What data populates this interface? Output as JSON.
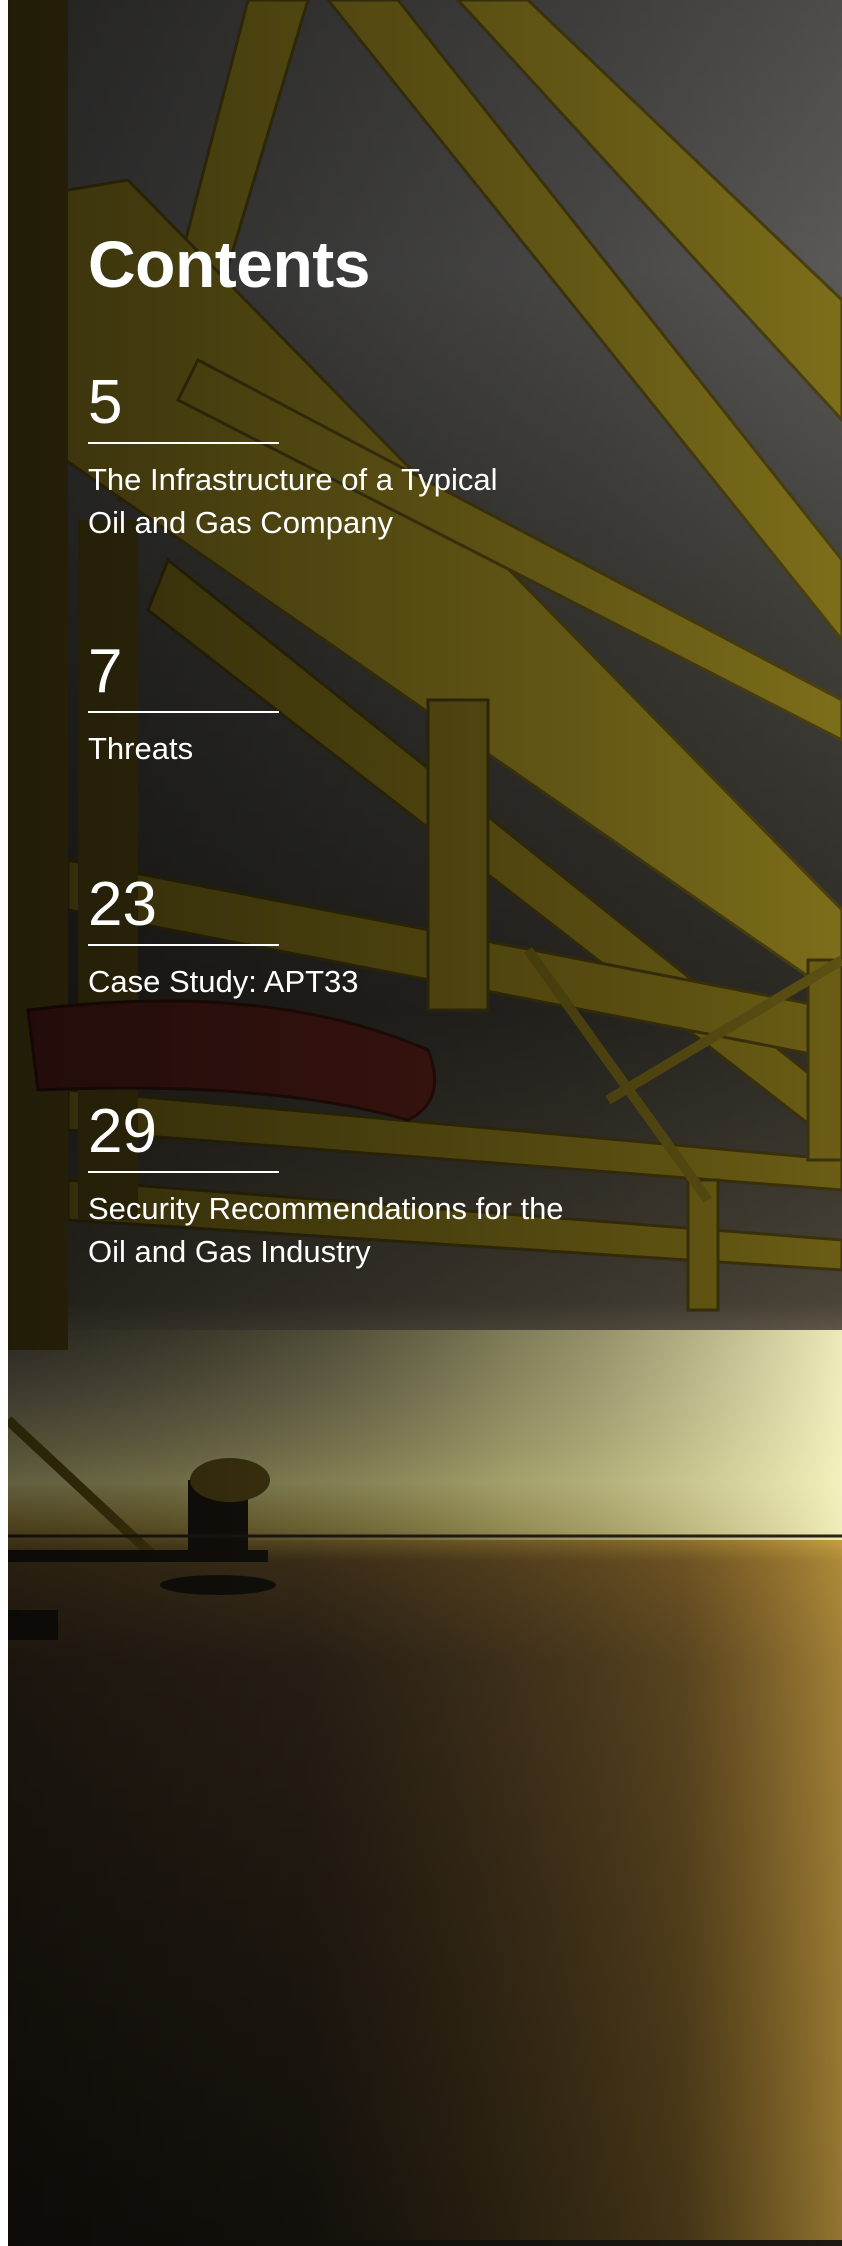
{
  "page": {
    "title": "Contents",
    "entries": [
      {
        "page_number": "5",
        "label": "The Infrastructure of a Typical\nOil and Gas Company"
      },
      {
        "page_number": "7",
        "label": "Threats"
      },
      {
        "page_number": "23",
        "label": "Case Study: APT33"
      },
      {
        "page_number": "29",
        "label": "Security Recommendations for the\nOil and Gas Industry"
      }
    ]
  },
  "colors": {
    "text": "#ffffff",
    "beam": "#8a7a1c",
    "sun": "#e8e48a",
    "sea": "#2e2418"
  },
  "background": {
    "subject": "offshore-oil-platform-at-sunset-photo"
  }
}
